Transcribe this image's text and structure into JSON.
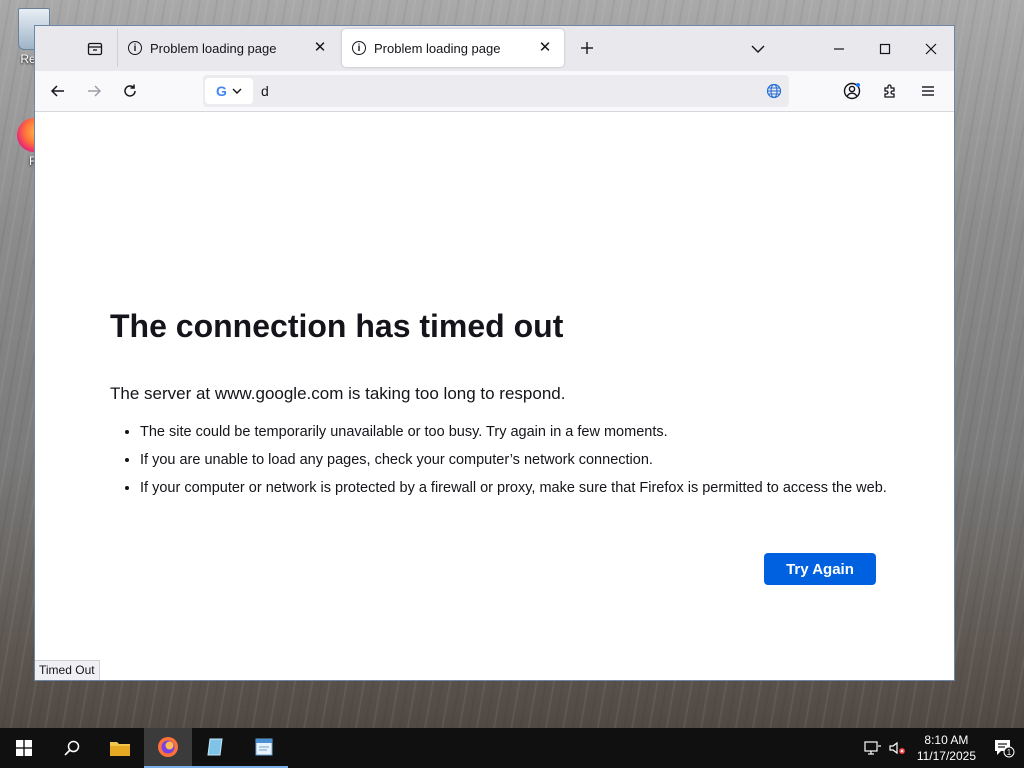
{
  "desktop": {
    "icons": [
      {
        "label": "Recy"
      },
      {
        "label": "Fi"
      }
    ]
  },
  "browser": {
    "tabs": [
      {
        "title": "Problem loading page",
        "active": false
      },
      {
        "title": "Problem loading page",
        "active": true
      }
    ],
    "url_value": "d",
    "search_engine": "G",
    "status_text": "Timed Out"
  },
  "error_page": {
    "title": "The connection has timed out",
    "description": "The server at www.google.com is taking too long to respond.",
    "suggestions": [
      "The site could be temporarily unavailable or too busy. Try again in a few moments.",
      "If you are unable to load any pages, check your computer’s network connection.",
      "If your computer or network is protected by a firewall or proxy, make sure that Firefox is permitted to access the web."
    ],
    "try_again_label": "Try Again"
  },
  "taskbar": {
    "clock_time": "8:10 AM",
    "clock_date": "11/17/2025",
    "notification_count": "1"
  },
  "colors": {
    "accent_button": "#0061e0",
    "taskbar": "#101010"
  }
}
